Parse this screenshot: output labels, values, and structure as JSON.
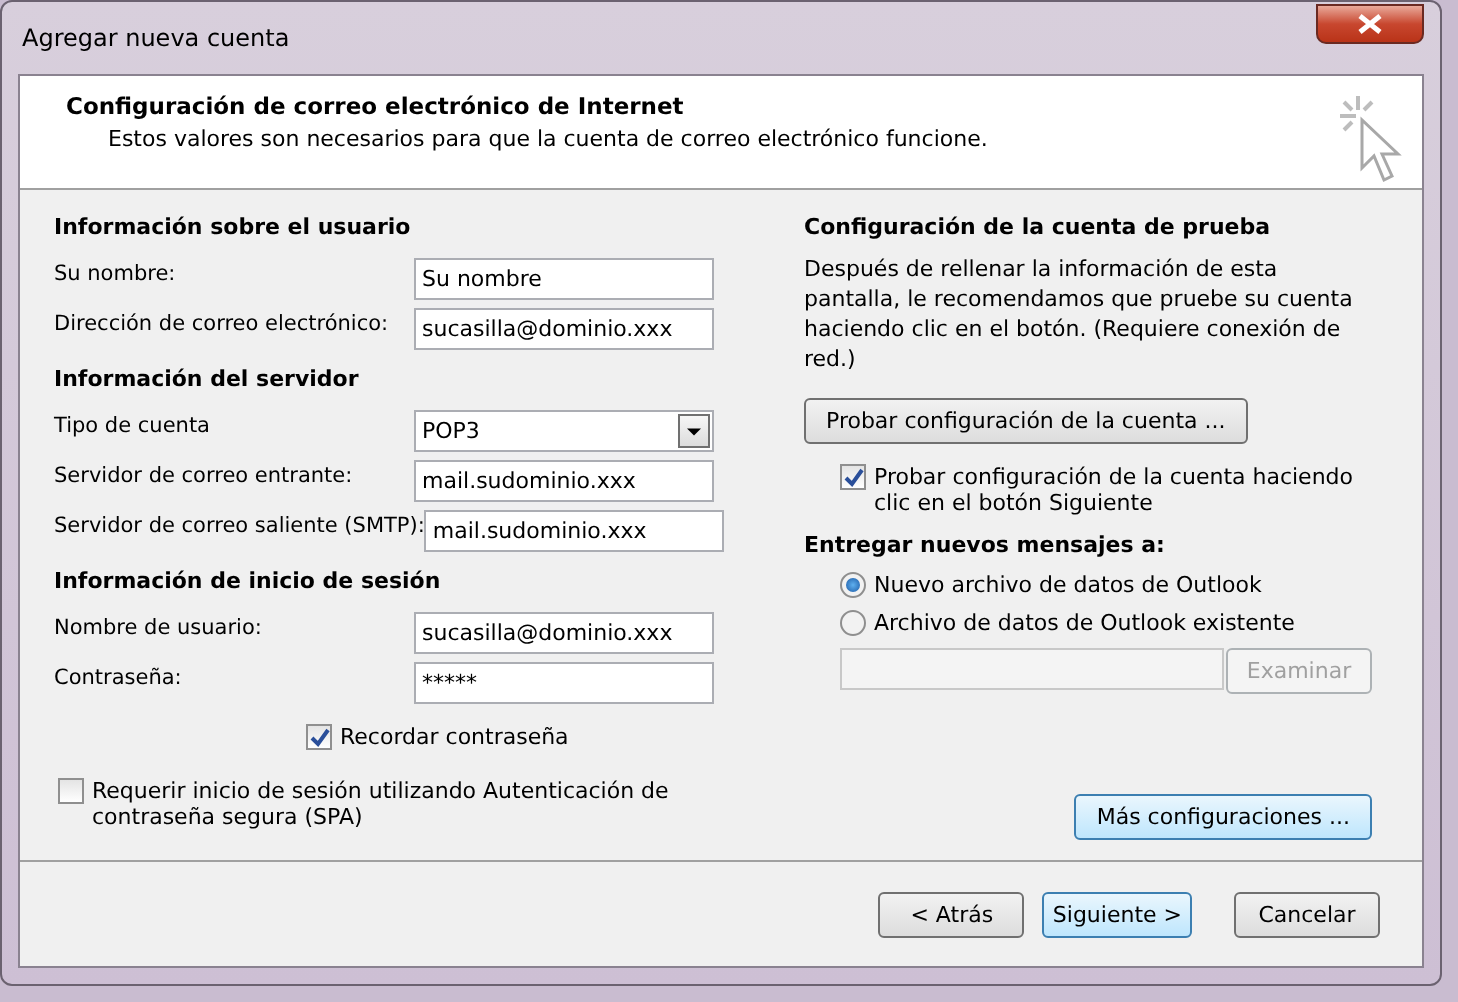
{
  "window": {
    "title": "Agregar nueva cuenta"
  },
  "header": {
    "title": "Configuración de correo electrónico de Internet",
    "subtitle": "Estos valores son necesarios para que la cuenta de correo electrónico funcione."
  },
  "left_sections": [
    {
      "heading": "Información sobre el usuario",
      "fields": [
        {
          "kind": "text",
          "label": "Su nombre:",
          "value": "Su nombre"
        },
        {
          "kind": "text",
          "label": "Dirección de correo electrónico:",
          "value": "sucasilla@dominio.xxx"
        }
      ]
    },
    {
      "heading": "Información del servidor",
      "fields": [
        {
          "kind": "dropdown",
          "label": "Tipo de cuenta",
          "value": "POP3"
        },
        {
          "kind": "text",
          "label": "Servidor de correo entrante:",
          "value": "mail.sudominio.xxx"
        },
        {
          "kind": "text",
          "label": "Servidor de correo saliente (SMTP):",
          "value": "mail.sudominio.xxx"
        }
      ]
    },
    {
      "heading": "Información de inicio de sesión",
      "fields": [
        {
          "kind": "text",
          "label": "Nombre de usuario:",
          "value": "sucasilla@dominio.xxx"
        },
        {
          "kind": "password",
          "label": "Contraseña:",
          "value": "*****"
        }
      ]
    }
  ],
  "remember_password": {
    "label": "Recordar contraseña",
    "checked": true
  },
  "spa": {
    "label": "Requerir inicio de sesión utilizando Autenticación de contraseña segura (SPA)",
    "checked": false
  },
  "test": {
    "heading": "Configuración de la cuenta de prueba",
    "text": "Después de rellenar la información de esta pantalla, le recomendamos que pruebe su cuenta haciendo clic en el botón. (Requiere conexión de red.)",
    "button": "Probar configuración de la cuenta ...",
    "checkbox": {
      "label": "Probar configuración de la cuenta haciendo clic en el botón Siguiente",
      "checked": true
    }
  },
  "deliver": {
    "heading": "Entregar nuevos mensajes a:",
    "options": [
      {
        "label": "Nuevo archivo de datos de Outlook",
        "selected": true
      },
      {
        "label": "Archivo de datos de Outlook existente",
        "selected": false
      }
    ],
    "browse": {
      "label": "Examinar",
      "disabled": true
    }
  },
  "more_button": "Más configuraciones ...",
  "footer_buttons": [
    {
      "label": "< Atrás",
      "default": false
    },
    {
      "label": "Siguiente >",
      "default": true
    },
    {
      "label": "Cancelar",
      "default": false
    }
  ]
}
